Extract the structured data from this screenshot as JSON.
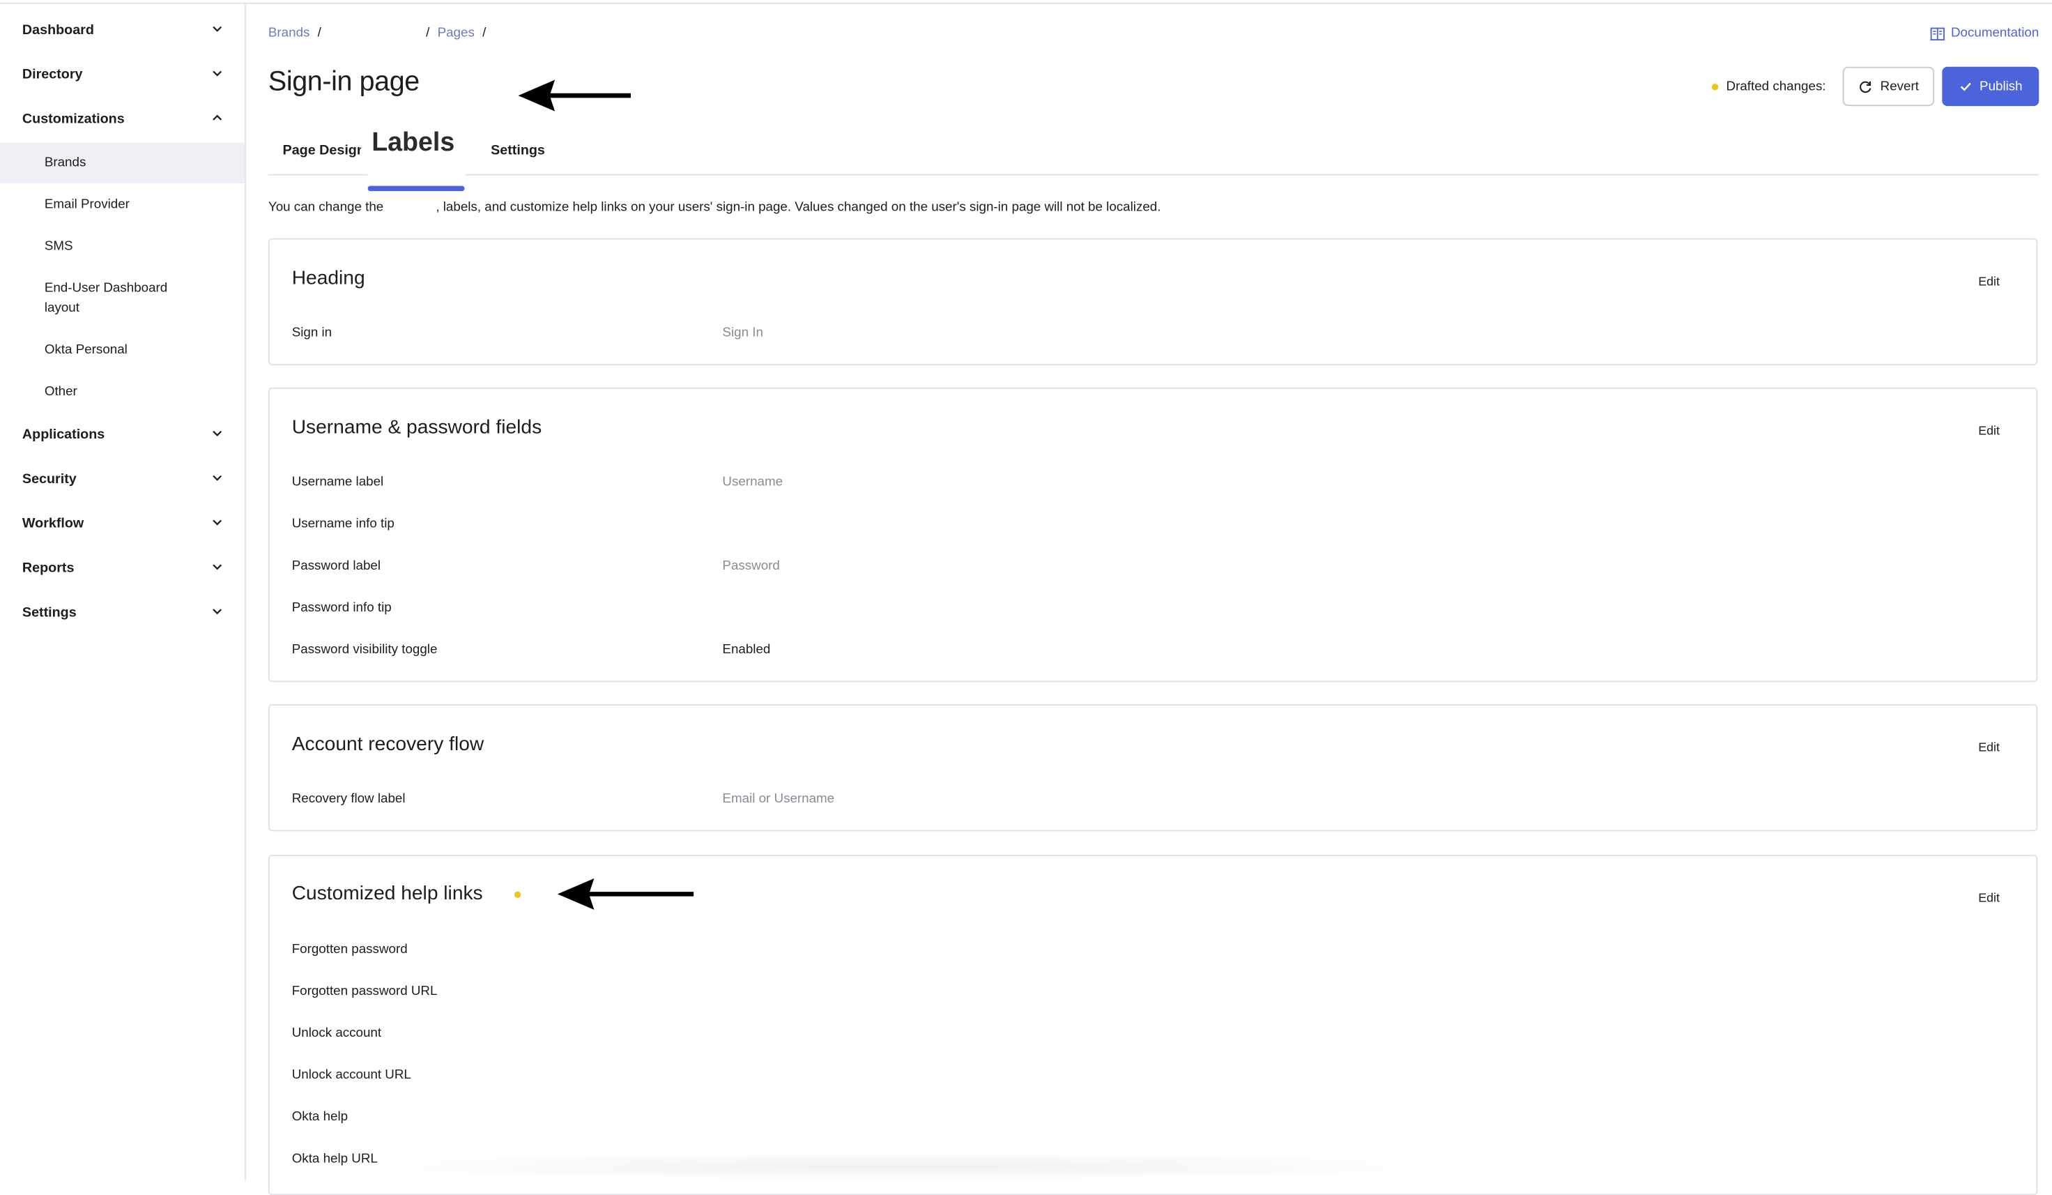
{
  "sidebar": {
    "groups": [
      {
        "label": "Dashboard",
        "expanded": false
      },
      {
        "label": "Directory",
        "expanded": false
      },
      {
        "label": "Customizations",
        "expanded": true
      },
      {
        "label": "Applications",
        "expanded": false
      },
      {
        "label": "Security",
        "expanded": false
      },
      {
        "label": "Workflow",
        "expanded": false
      },
      {
        "label": "Reports",
        "expanded": false
      },
      {
        "label": "Settings",
        "expanded": false
      }
    ],
    "customizations_items": [
      {
        "label": "Brands",
        "active": true
      },
      {
        "label": "Email Provider"
      },
      {
        "label": "SMS"
      },
      {
        "label": "End-User Dashboard layout"
      },
      {
        "label": "Okta Personal"
      },
      {
        "label": "Other"
      }
    ]
  },
  "breadcrumb": {
    "items": [
      "Brands",
      "Pages"
    ],
    "separator": "/"
  },
  "header": {
    "documentation_label": "Documentation",
    "page_title": "Sign-in page",
    "drafted_label": "Drafted changes:",
    "revert_label": "Revert",
    "publish_label": "Publish"
  },
  "tabs": [
    {
      "label": "Page Design"
    },
    {
      "label": "Labels",
      "active": true
    },
    {
      "label": "Settings"
    }
  ],
  "description": {
    "before": "You can change the",
    "after": ", labels, and customize help links on your users' sign-in page. Values changed on the user's sign-in page will not be localized."
  },
  "sections": {
    "heading": {
      "title": "Heading",
      "edit_label": "Edit",
      "rows": [
        {
          "label": "Sign in",
          "value": "Sign In"
        }
      ]
    },
    "username_password": {
      "title": "Username & password fields",
      "edit_label": "Edit",
      "rows": [
        {
          "label": "Username label",
          "value": "Username"
        },
        {
          "label": "Username info tip",
          "value": ""
        },
        {
          "label": "Password label",
          "value": "Password"
        },
        {
          "label": "Password info tip",
          "value": ""
        },
        {
          "label": "Password visibility toggle",
          "value": "Enabled"
        }
      ]
    },
    "account_recovery": {
      "title": "Account recovery flow",
      "edit_label": "Edit",
      "rows": [
        {
          "label": "Recovery flow label",
          "value": "Email or Username"
        }
      ]
    },
    "help_links": {
      "title": "Customized help links",
      "edit_label": "Edit",
      "rows": [
        {
          "label": "Forgotten password"
        },
        {
          "label": "Forgotten password URL"
        },
        {
          "label": "Unlock account"
        },
        {
          "label": "Unlock account URL"
        },
        {
          "label": "Okta help"
        },
        {
          "label": "Okta help URL"
        }
      ]
    }
  },
  "colors": {
    "accent": "#4b63db",
    "draft_dot": "#f0c419",
    "link": "#6e7cb7"
  }
}
